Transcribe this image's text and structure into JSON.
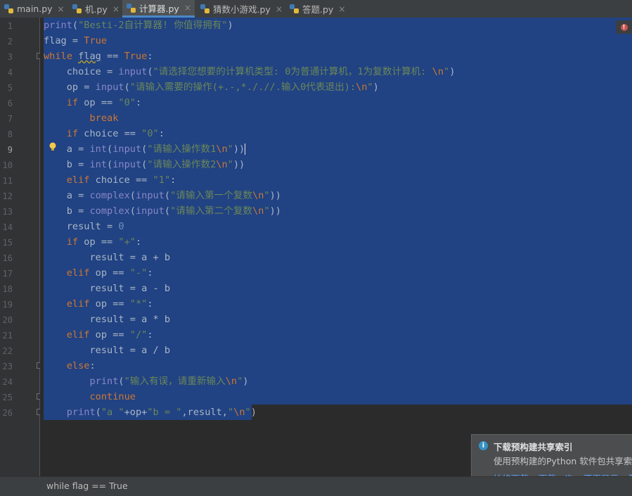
{
  "tabs": [
    {
      "label": "main.py",
      "active": false
    },
    {
      "label": "机.py",
      "active": false
    },
    {
      "label": "计算器.py",
      "active": true
    },
    {
      "label": "猜数小游戏.py",
      "active": false
    },
    {
      "label": "答题.py",
      "active": false
    }
  ],
  "tab_close_glyph": "×",
  "line_numbers": [
    "1",
    "2",
    "3",
    "4",
    "5",
    "6",
    "7",
    "8",
    "9",
    "10",
    "11",
    "12",
    "13",
    "14",
    "15",
    "16",
    "17",
    "18",
    "19",
    "20",
    "21",
    "22",
    "23",
    "24",
    "25",
    "26"
  ],
  "current_line": "9",
  "breadcrumb": "while flag == True",
  "notification": {
    "title": "下载预构建共享索引",
    "body": "使用预构建的Python 软件包共享索引",
    "actions": [
      "始终下载",
      "下载一次",
      "不再显示",
      "配"
    ]
  },
  "colors": {
    "selection": "#214283",
    "keyword": "#cc7832",
    "string": "#6a8759",
    "builtin": "#8888c6",
    "number": "#6897bb",
    "error": "#c75450"
  }
}
